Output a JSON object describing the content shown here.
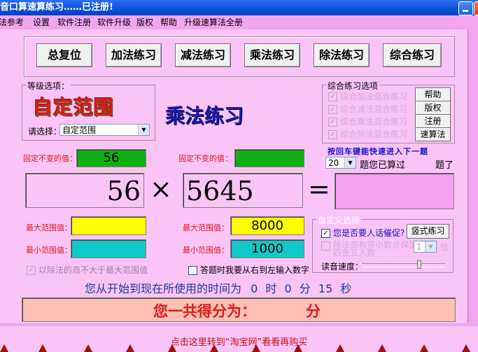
{
  "window": {
    "title": "音口算速算练习……已注册!"
  },
  "menu": [
    "法参考",
    "设置",
    "软件注册",
    "软件升级",
    "版权",
    "帮助",
    "升级速算法全册"
  ],
  "toolbar": {
    "reset": "总复位",
    "add": "加法练习",
    "sub": "减法练习",
    "mul": "乘法练习",
    "div": "除法练习",
    "mix": "综合练习"
  },
  "level": {
    "group_label": "等级选项：",
    "custom_title": "自定范围",
    "choose_label": "请选择：",
    "choose_value": "自定范围"
  },
  "mode_title": "乘法练习",
  "combo": {
    "group_label": "综合练习选项",
    "options": [
      "综合加法混合练习",
      "综合减法混合练习",
      "综合乘法混合练习",
      "综合除法混合练习"
    ],
    "buttons": [
      "帮助",
      "版权",
      "注册",
      "速算法"
    ]
  },
  "hint": "按回车键能快速进入下一题",
  "count": {
    "value": "20",
    "label1": "题您已算过",
    "label2": "题了"
  },
  "fixed": {
    "label_left": "固定不变的值：",
    "label_right": "固定不变的值：",
    "left_value": "56",
    "right_value": ""
  },
  "equation": {
    "operand1": "56",
    "operator": "×",
    "operand2": "5645",
    "equals": "=",
    "answer": ""
  },
  "range": {
    "max_label_left": "最大范围值：",
    "min_label_left": "最小范围值：",
    "max_label_right": "最大范围值：",
    "min_label_right": "最小范围值：",
    "max_left": "",
    "min_left": "",
    "max_right": "8000",
    "min_right": "1000"
  },
  "options": {
    "div_check": "以除法的商不大于最大范围值",
    "rtl_check": "答题时我要从右到左输入数字"
  },
  "custom": {
    "group_label": "自定义选择",
    "voice_check": "您是否要人话催促?",
    "vertical_btn": "竖式练习",
    "decimal_check": "除法商有带小数点保留",
    "decimal_check2": "四舍五入数",
    "decimal_unit": "位",
    "decimal_value": "1",
    "speed_label": "读音速度："
  },
  "timer": {
    "prefix": "您从开始到现在所使用的时间为",
    "h": "0",
    "hu": "时",
    "m": "0",
    "mu": "分",
    "s": "15",
    "su": "秒"
  },
  "score": {
    "label": "您一共得分为：",
    "unit": "分"
  },
  "footer": "点击这里转到“淘宝网”看看再购买",
  "colors": {
    "green": "#10b010",
    "yellow": "#ffff00",
    "cyan": "#10c8c8",
    "answer": "#f5a0f0"
  }
}
